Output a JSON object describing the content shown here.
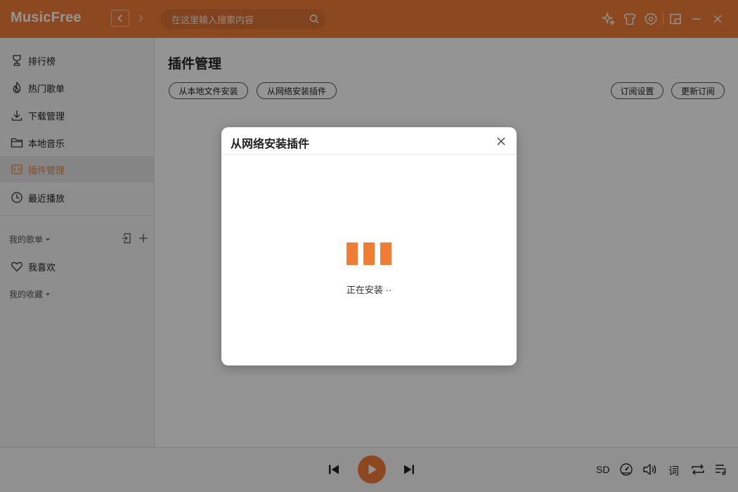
{
  "app": {
    "name": "MusicFree",
    "accent_color": "#f17d34"
  },
  "header": {
    "back_icon": "chevron-left-icon",
    "forward_icon": "chevron-right-icon",
    "search_placeholder": "在这里输入搜索内容",
    "search_icon": "search-icon",
    "right_icons": [
      "sparkle-icon",
      "shirt-icon",
      "gear-icon",
      "minimode-icon",
      "minimize-icon",
      "close-icon"
    ]
  },
  "sidebar": {
    "items": [
      {
        "label": "排行榜",
        "icon": "trophy-icon",
        "active": false
      },
      {
        "label": "热门歌单",
        "icon": "fire-icon",
        "active": false
      },
      {
        "label": "下载管理",
        "icon": "download-icon",
        "active": false
      },
      {
        "label": "本地音乐",
        "icon": "folder-icon",
        "active": false
      },
      {
        "label": "插件管理",
        "icon": "plugin-icon",
        "active": true
      },
      {
        "label": "最近播放",
        "icon": "clock-icon",
        "active": false
      }
    ],
    "my_playlists": {
      "title": "我的歌单",
      "import_icon": "import-icon",
      "add_icon": "plus-icon"
    },
    "favorite": {
      "label": "我喜欢",
      "icon": "heart-icon"
    },
    "my_collections": {
      "title": "我的收藏"
    }
  },
  "main": {
    "title": "插件管理",
    "buttons_left": [
      "从本地文件安装",
      "从网络安装插件"
    ],
    "buttons_right": [
      "订阅设置",
      "更新订阅"
    ]
  },
  "modal": {
    "title": "从网络安装插件",
    "close_icon": "close-icon",
    "loading_icon": "loading-bars-icon",
    "status": "正在安装 ··"
  },
  "player": {
    "prev_icon": "skip-previous-icon",
    "play_icon": "play-icon",
    "next_icon": "skip-next-icon",
    "quality": "SD",
    "speed_icon": "speedometer-icon",
    "volume_icon": "volume-icon",
    "lyric": "词",
    "repeat_icon": "repeat-icon",
    "playlist_icon": "playlist-icon"
  }
}
